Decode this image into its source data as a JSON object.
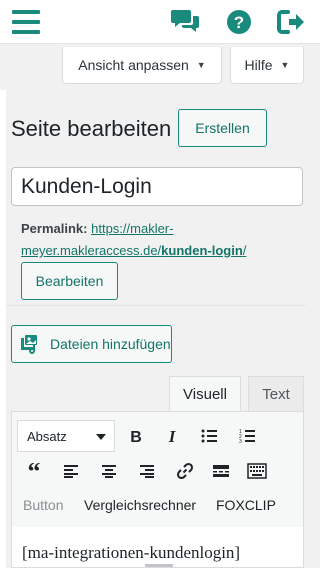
{
  "topbar": {
    "menu_icon": "hamburger-menu-icon",
    "icons": [
      "chat-bubbles-icon",
      "help-question-icon",
      "logout-icon"
    ],
    "accent_color": "#1a8a7c"
  },
  "screen_options": {
    "view_label": "Ansicht anpassen",
    "help_label": "Hilfe"
  },
  "header": {
    "title": "Seite bearbeiten",
    "create_label": "Erstellen"
  },
  "post": {
    "title_value": "Kunden-Login"
  },
  "permalink": {
    "label": "Permalink:",
    "url_base": "https://makler-meyer.makleraccess.de/",
    "slug": "kunden-login",
    "url_end": "/",
    "edit_label": "Bearbeiten"
  },
  "editor": {
    "add_media_label": "Dateien hinzufügen",
    "tab_visual": "Visuell",
    "tab_text": "Text",
    "format_select": "Absatz",
    "row3_buttons": [
      "Button",
      "Vergleichsrechner",
      "FOXCLIP"
    ],
    "content": "[ma-integrationen-kundenlogin]"
  }
}
